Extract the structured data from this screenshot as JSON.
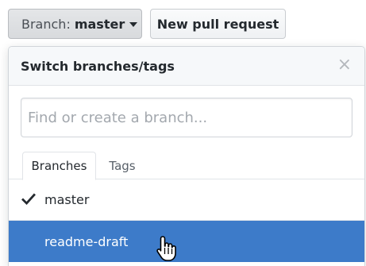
{
  "toolbar": {
    "branch_prefix": "Branch:",
    "branch_name": "master",
    "new_pr_label": "New pull request"
  },
  "dropdown": {
    "title": "Switch branches/tags",
    "close_glyph": "×",
    "filter_placeholder": "Find or create a branch...",
    "tabs": [
      {
        "label": "Branches",
        "selected": true
      },
      {
        "label": "Tags",
        "selected": false
      }
    ],
    "items": [
      {
        "label": "master",
        "checked": true,
        "highlighted": false
      },
      {
        "label": "readme-draft",
        "checked": false,
        "highlighted": true
      }
    ]
  },
  "icons": {
    "caret": "caret-down-icon",
    "close": "close-icon",
    "check": "check-icon",
    "cursor": "hand-pointer-cursor-icon"
  },
  "colors": {
    "highlight": "#3d7bc9",
    "header_bg": "#f6f8fa",
    "text": "#24292e"
  }
}
